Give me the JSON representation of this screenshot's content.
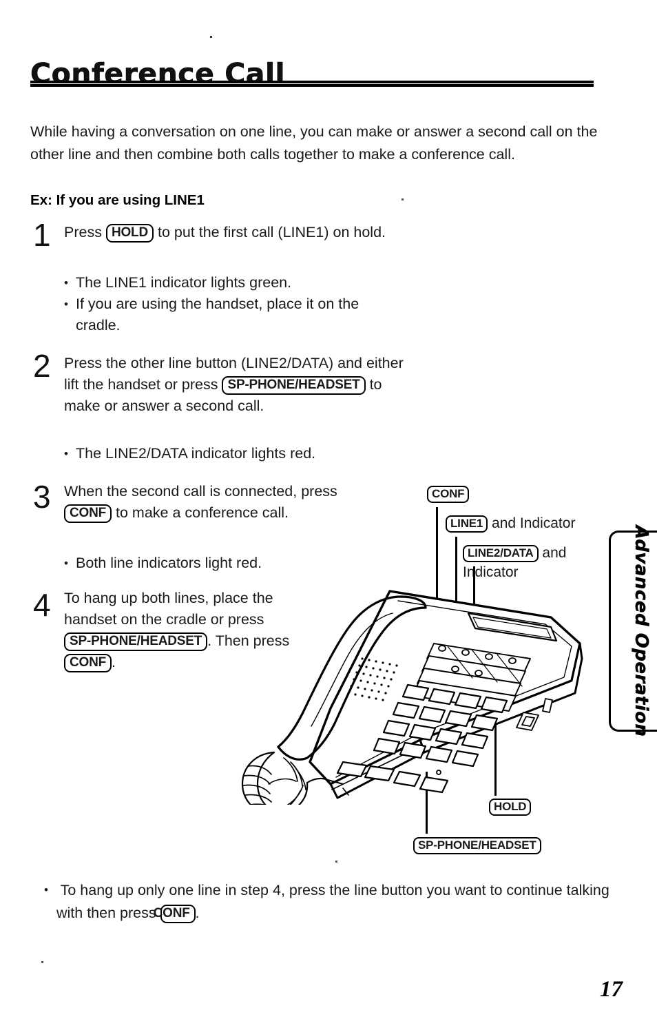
{
  "page": {
    "title": "Conference Call",
    "number": "17",
    "side_tab_label": "Advanced Operation"
  },
  "intro": "While having a conversation on one line, you can make or answer a second call on the other line and then combine both calls together to make a conference call.",
  "example_heading": "Ex: If you are using LINE1",
  "steps": [
    {
      "number": "1",
      "text_before": "Press",
      "key": "HOLD",
      "text_after": "to put the first call (LINE1) on hold.",
      "bullets": [
        "The LINE1 indicator lights green.",
        "If you are using the handset, place it on the cradle."
      ]
    },
    {
      "number": "2",
      "text_before": "Press the other line button (LINE2/DATA) and either lift the handset or press",
      "key": "SP-PHONE/HEADSET",
      "text_after": "to make or answer a second call.",
      "bullets": [
        "The LINE2/DATA indicator lights red."
      ]
    },
    {
      "number": "3",
      "text_before": "When the second call is connected, press",
      "key": "CONF",
      "text_after": "to make a conference call.",
      "bullets": [
        "Both line indicators light red."
      ]
    },
    {
      "number": "4",
      "text_before": "To hang up both lines, place the handset on the cradle or press",
      "key": "SP-PHONE/HEADSET",
      "text_after": ".",
      "text_then": "Then press",
      "key2": "CONF",
      "text_end": ".",
      "bullets": []
    }
  ],
  "figure": {
    "name": "two-line-desk-telephone-illustration",
    "callouts": [
      {
        "key": "CONF",
        "suffix": ""
      },
      {
        "key": "LINE1",
        "suffix": " and Indicator"
      },
      {
        "key": "LINE2/DATA",
        "suffix": " and",
        "suffix2": "Indicator"
      },
      {
        "key": "HOLD",
        "suffix": ""
      },
      {
        "key": "SP-PHONE/HEADSET",
        "suffix": ""
      }
    ]
  },
  "bottom_note": {
    "text_before": "To hang up only one line in step 4, press the line button you want to continue talking with then press",
    "key": "CONF",
    "text_after": "."
  }
}
